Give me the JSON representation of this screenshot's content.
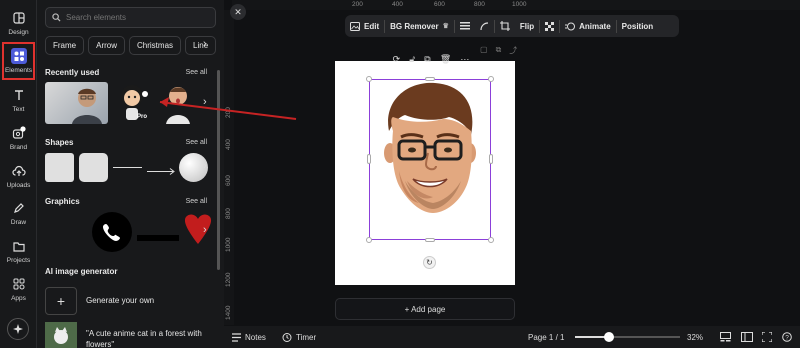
{
  "rail": {
    "items": [
      {
        "label": "Design",
        "icon": "layout-icon"
      },
      {
        "label": "Elements",
        "icon": "shapes-icon"
      },
      {
        "label": "Text",
        "icon": "text-icon"
      },
      {
        "label": "Brand",
        "icon": "brand-icon"
      },
      {
        "label": "Uploads",
        "icon": "upload-cloud-icon"
      },
      {
        "label": "Draw",
        "icon": "pen-icon"
      },
      {
        "label": "Projects",
        "icon": "folder-icon"
      },
      {
        "label": "Apps",
        "icon": "apps-icon"
      }
    ],
    "active": "Elements"
  },
  "panel": {
    "search_placeholder": "Search elements",
    "chips": [
      "Frame",
      "Arrow",
      "Christmas",
      "Line"
    ],
    "recently_used": {
      "title": "Recently used",
      "see_all": "See all",
      "pro_badge": "Pro"
    },
    "shapes": {
      "title": "Shapes",
      "see_all": "See all"
    },
    "graphics": {
      "title": "Graphics",
      "see_all": "See all"
    },
    "ai_generator": {
      "title": "AI image generator",
      "generate_label": "Generate your own",
      "prompt_example": "\"A cute anime cat in a forest with flowers\""
    }
  },
  "toolbar": {
    "edit": "Edit",
    "bg_remover": "BG Remover",
    "flip": "Flip",
    "animate": "Animate",
    "position": "Position"
  },
  "rulers": {
    "top": [
      "200",
      "400",
      "600",
      "800",
      "1000"
    ],
    "left": [
      "200",
      "400",
      "600",
      "800",
      "1000",
      "1200",
      "1400"
    ]
  },
  "canvas": {
    "add_page": "+ Add page"
  },
  "bottom_bar": {
    "notes": "Notes",
    "timer": "Timer",
    "page_indicator": "Page 1 / 1",
    "zoom": "32%",
    "zoom_level": 0.32
  },
  "colors": {
    "accent": "#4d5bd8",
    "selection": "#8b3fd9",
    "highlight": "#e0322e"
  }
}
